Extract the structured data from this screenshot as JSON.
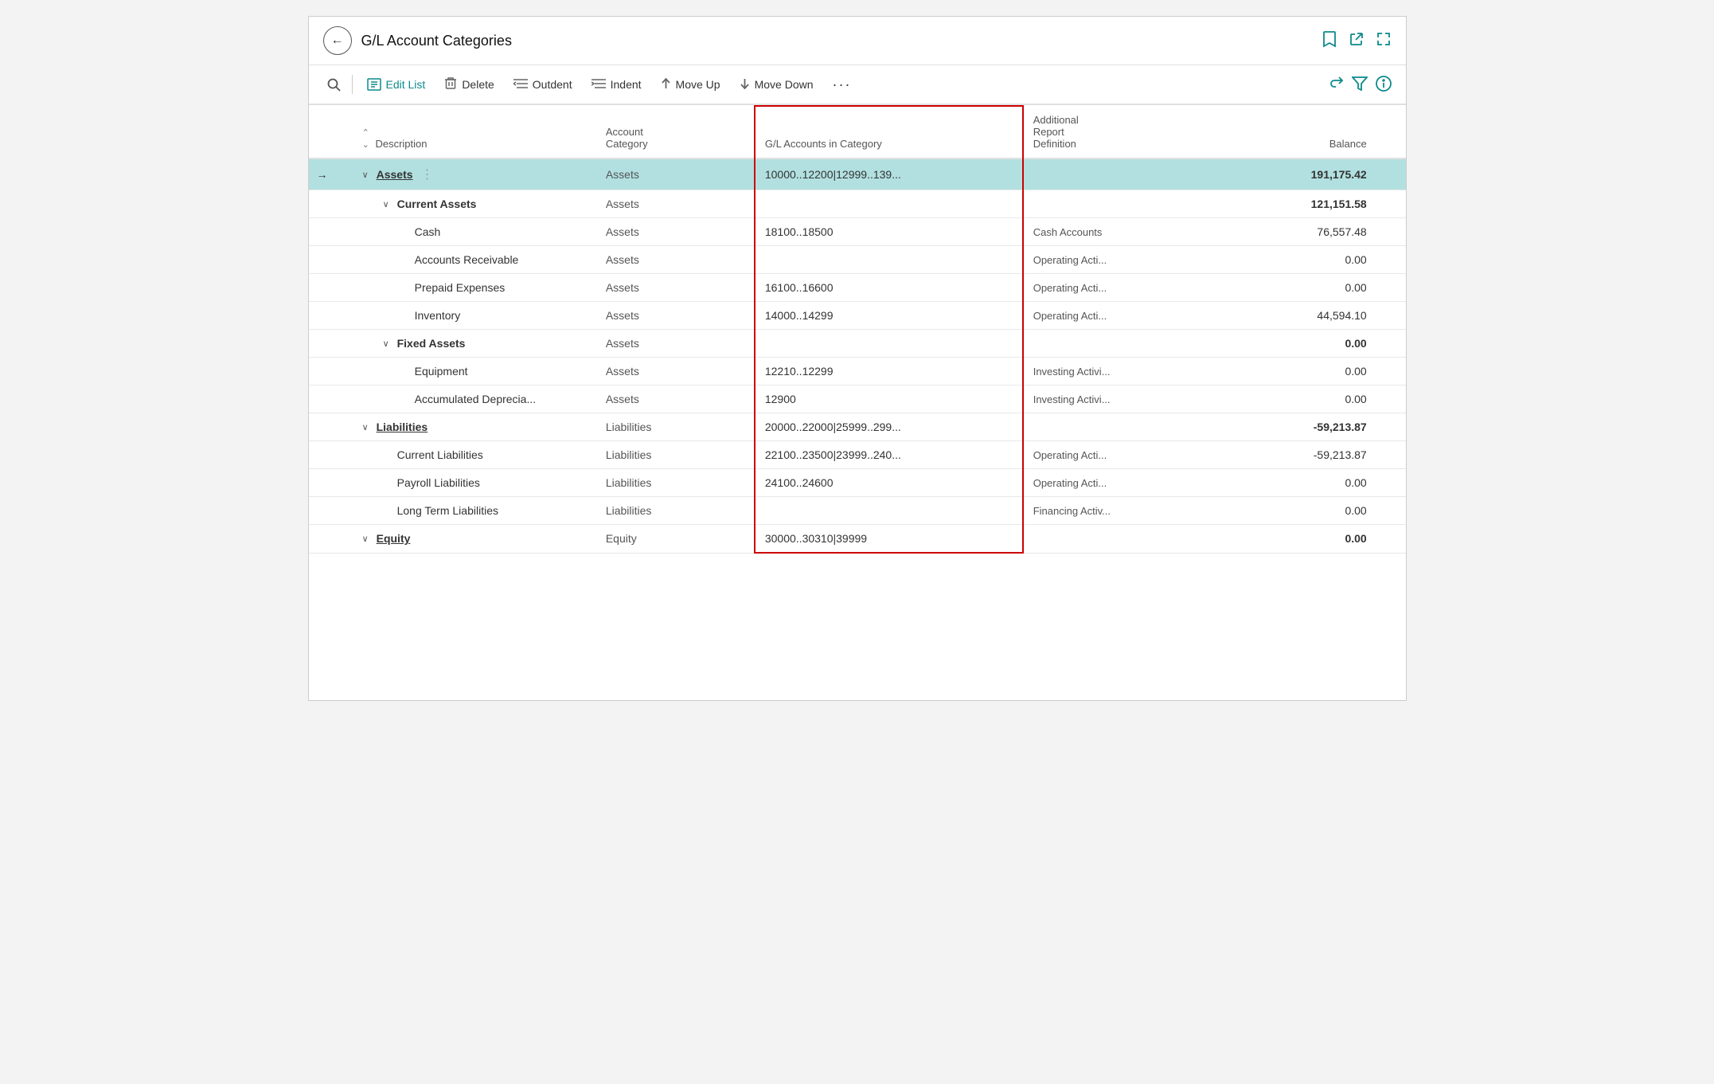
{
  "header": {
    "title": "G/L Account Categories",
    "back_label": "←",
    "icons": [
      "bookmark",
      "external-link",
      "expand"
    ]
  },
  "toolbar": {
    "search_icon": "🔍",
    "edit_list_label": "Edit List",
    "delete_label": "Delete",
    "outdent_label": "Outdent",
    "indent_label": "Indent",
    "move_up_label": "Move Up",
    "move_down_label": "Move Down",
    "more_label": "···",
    "share_icon": "↑",
    "filter_icon": "▽",
    "info_icon": "ℹ"
  },
  "table": {
    "columns": [
      {
        "id": "arrow",
        "label": ""
      },
      {
        "id": "chevron",
        "label": ""
      },
      {
        "id": "description",
        "label": "Description",
        "has_sort": true
      },
      {
        "id": "account_category",
        "label": "Account\nCategory"
      },
      {
        "id": "gl_accounts",
        "label": "G/L Accounts in Category"
      },
      {
        "id": "additional_report",
        "label": "Additional\nReport\nDefinition"
      },
      {
        "id": "balance",
        "label": "Balance"
      }
    ],
    "rows": [
      {
        "id": 1,
        "arrow": "→",
        "chevron": "∨",
        "description": "Assets",
        "description_bold": true,
        "has_drag": true,
        "account_category": "Assets",
        "gl_accounts": "10000..12200|12999..139...",
        "additional_report": "",
        "balance": "191,175.42",
        "balance_bold": true,
        "selected": true,
        "indent": 0
      },
      {
        "id": 2,
        "arrow": "",
        "chevron": "∨",
        "description": "Current Assets",
        "description_bold": true,
        "has_drag": false,
        "account_category": "Assets",
        "gl_accounts": "",
        "additional_report": "",
        "balance": "121,151.58",
        "balance_bold": true,
        "selected": false,
        "indent": 1
      },
      {
        "id": 3,
        "arrow": "",
        "chevron": "",
        "description": "Cash",
        "description_bold": false,
        "has_drag": false,
        "account_category": "Assets",
        "gl_accounts": "18100..18500",
        "additional_report": "Cash Accounts",
        "balance": "76,557.48",
        "balance_bold": false,
        "selected": false,
        "indent": 2
      },
      {
        "id": 4,
        "arrow": "",
        "chevron": "",
        "description": "Accounts Receivable",
        "description_bold": false,
        "has_drag": false,
        "account_category": "Assets",
        "gl_accounts": "",
        "additional_report": "Operating Acti...",
        "balance": "0.00",
        "balance_bold": false,
        "selected": false,
        "indent": 2
      },
      {
        "id": 5,
        "arrow": "",
        "chevron": "",
        "description": "Prepaid Expenses",
        "description_bold": false,
        "has_drag": false,
        "account_category": "Assets",
        "gl_accounts": "16100..16600",
        "additional_report": "Operating Acti...",
        "balance": "0.00",
        "balance_bold": false,
        "selected": false,
        "indent": 2
      },
      {
        "id": 6,
        "arrow": "",
        "chevron": "",
        "description": "Inventory",
        "description_bold": false,
        "has_drag": false,
        "account_category": "Assets",
        "gl_accounts": "14000..14299",
        "additional_report": "Operating Acti...",
        "balance": "44,594.10",
        "balance_bold": false,
        "selected": false,
        "indent": 2
      },
      {
        "id": 7,
        "arrow": "",
        "chevron": "∨",
        "description": "Fixed Assets",
        "description_bold": true,
        "has_drag": false,
        "account_category": "Assets",
        "gl_accounts": "",
        "additional_report": "",
        "balance": "0.00",
        "balance_bold": true,
        "selected": false,
        "indent": 1
      },
      {
        "id": 8,
        "arrow": "",
        "chevron": "",
        "description": "Equipment",
        "description_bold": false,
        "has_drag": false,
        "account_category": "Assets",
        "gl_accounts": "12210..12299",
        "additional_report": "Investing Activi...",
        "balance": "0.00",
        "balance_bold": false,
        "selected": false,
        "indent": 2
      },
      {
        "id": 9,
        "arrow": "",
        "chevron": "",
        "description": "Accumulated Deprecia...",
        "description_bold": false,
        "has_drag": false,
        "account_category": "Assets",
        "gl_accounts": "12900",
        "additional_report": "Investing Activi...",
        "balance": "0.00",
        "balance_bold": false,
        "selected": false,
        "indent": 2
      },
      {
        "id": 10,
        "arrow": "",
        "chevron": "∨",
        "description": "Liabilities",
        "description_bold": true,
        "has_drag": false,
        "account_category": "Liabilities",
        "gl_accounts": "20000..22000|25999..299...",
        "additional_report": "",
        "balance": "-59,213.87",
        "balance_bold": true,
        "selected": false,
        "indent": 0
      },
      {
        "id": 11,
        "arrow": "",
        "chevron": "",
        "description": "Current Liabilities",
        "description_bold": false,
        "has_drag": false,
        "account_category": "Liabilities",
        "gl_accounts": "22100..23500|23999..240...",
        "additional_report": "Operating Acti...",
        "balance": "-59,213.87",
        "balance_bold": false,
        "selected": false,
        "indent": 1
      },
      {
        "id": 12,
        "arrow": "",
        "chevron": "",
        "description": "Payroll Liabilities",
        "description_bold": false,
        "has_drag": false,
        "account_category": "Liabilities",
        "gl_accounts": "24100..24600",
        "additional_report": "Operating Acti...",
        "balance": "0.00",
        "balance_bold": false,
        "selected": false,
        "indent": 1
      },
      {
        "id": 13,
        "arrow": "",
        "chevron": "",
        "description": "Long Term Liabilities",
        "description_bold": false,
        "has_drag": false,
        "account_category": "Liabilities",
        "gl_accounts": "",
        "additional_report": "Financing Activ...",
        "balance": "0.00",
        "balance_bold": false,
        "selected": false,
        "indent": 1
      },
      {
        "id": 14,
        "arrow": "",
        "chevron": "∨",
        "description": "Equity",
        "description_bold": true,
        "has_drag": false,
        "account_category": "Equity",
        "gl_accounts": "30000..30310|39999",
        "additional_report": "",
        "balance": "0.00",
        "balance_bold": true,
        "selected": false,
        "indent": 0
      }
    ]
  },
  "highlight_column": "gl_accounts",
  "colors": {
    "teal": "#0d8a8a",
    "selected_row_bg": "#b2e0e0",
    "highlight_border": "#cc0000"
  }
}
